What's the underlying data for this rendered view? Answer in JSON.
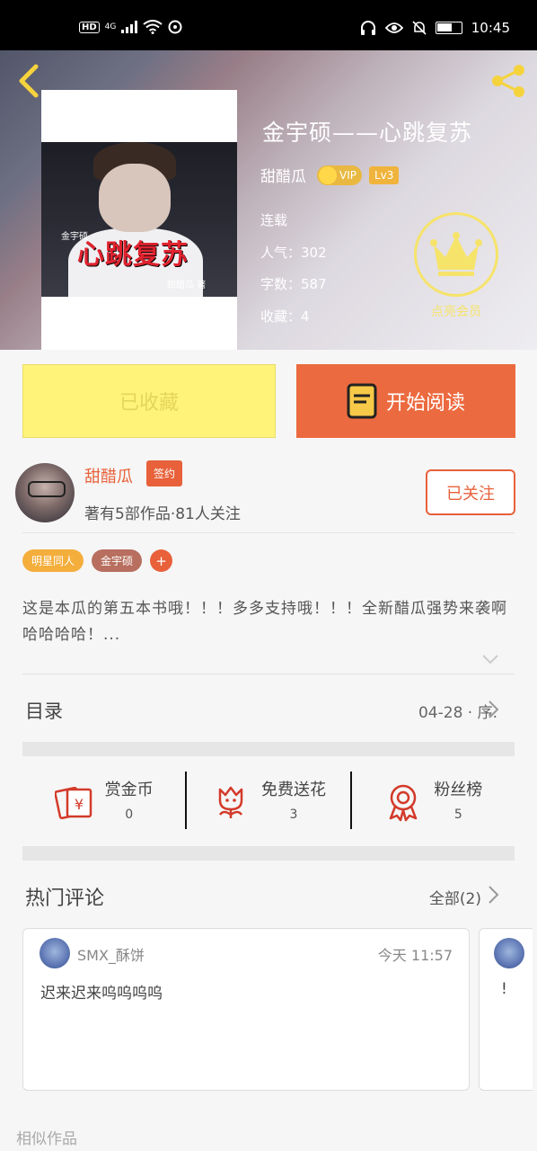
{
  "status_bar": {
    "hd": "HD",
    "network": "4G",
    "time": "10:45"
  },
  "header": {
    "book_title": "金宇硕——心跳复苏",
    "author": "甜醋瓜",
    "vip": "VIP",
    "level": "Lv3",
    "status": "连载",
    "popularity": "人气：302",
    "word_count": "字数：587",
    "favorites": "收藏：4",
    "member_label": "点亮会员",
    "cover": {
      "title": "心跳复苏",
      "small": "金宇硕",
      "author": "甜醋瓜 著"
    }
  },
  "actions": {
    "collected": "已收藏",
    "read": "开始阅读"
  },
  "author_block": {
    "name": "甜醋瓜",
    "badge": "签约",
    "desc": "著有5部作品·81人关注",
    "follow": "已关注"
  },
  "tags": [
    "明星同人",
    "金宇硕",
    "+"
  ],
  "synopsis": "这是本瓜的第五本书哦！！！多多支持哦！！！全新醋瓜强势来袭啊哈哈哈哈！...",
  "toc": {
    "label": "目录",
    "latest": "04-28 · 序."
  },
  "stats_row": [
    {
      "label": "赏金币",
      "value": "0",
      "icon": "money-gift-icon"
    },
    {
      "label": "免费送花",
      "value": "3",
      "icon": "flower-icon"
    },
    {
      "label": "粉丝榜",
      "value": "5",
      "icon": "medal-icon"
    }
  ],
  "comments": {
    "title": "热门评论",
    "all": "全部(2)",
    "items": [
      {
        "user": "SMX_酥饼",
        "time": "今天 11:57",
        "text": "迟来迟来呜呜呜呜"
      },
      {
        "user": "",
        "time": "",
        "text": "!"
      }
    ]
  },
  "similar": "相似作品",
  "colors": {
    "accent": "#ec6a3f",
    "collected_bg": "#fff37a",
    "gold": "#f6e36a"
  }
}
